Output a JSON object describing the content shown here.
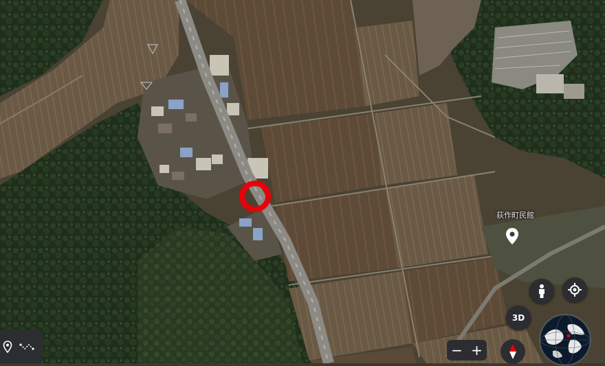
{
  "map": {
    "type": "satellite",
    "place_label": "荻作町民館",
    "marker": {
      "shape": "circle",
      "color": "#e8000b"
    }
  },
  "controls": {
    "three_d_label": "3D",
    "zoom_out_label": "−",
    "zoom_in_label": "+",
    "icons": [
      "person-icon",
      "my-location-icon",
      "compass-icon",
      "globe-icon",
      "location-pin-icon",
      "path-icon"
    ]
  },
  "colors": {
    "marker": "#e8000b",
    "control_bg": "#2b2d30"
  }
}
